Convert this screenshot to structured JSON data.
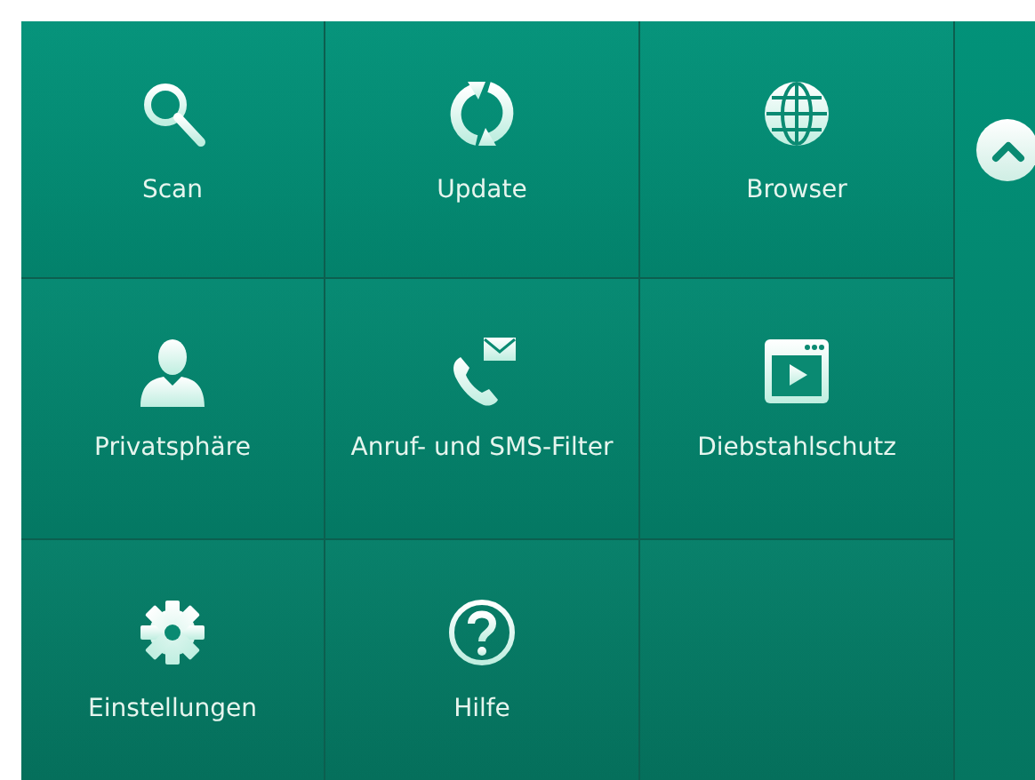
{
  "tiles": [
    {
      "kind": "search",
      "label": "Scan"
    },
    {
      "kind": "refresh",
      "label": "Update"
    },
    {
      "kind": "globe",
      "label": "Browser"
    },
    {
      "kind": "person",
      "label": "Privatsphäre"
    },
    {
      "kind": "phone",
      "label": "Anruf- und SMS-Filter"
    },
    {
      "kind": "video",
      "label": "Diebstahlschutz"
    },
    {
      "kind": "gear",
      "label": "Einstellungen"
    },
    {
      "kind": "help",
      "label": "Hilfe"
    },
    {
      "kind": "empty"
    }
  ]
}
